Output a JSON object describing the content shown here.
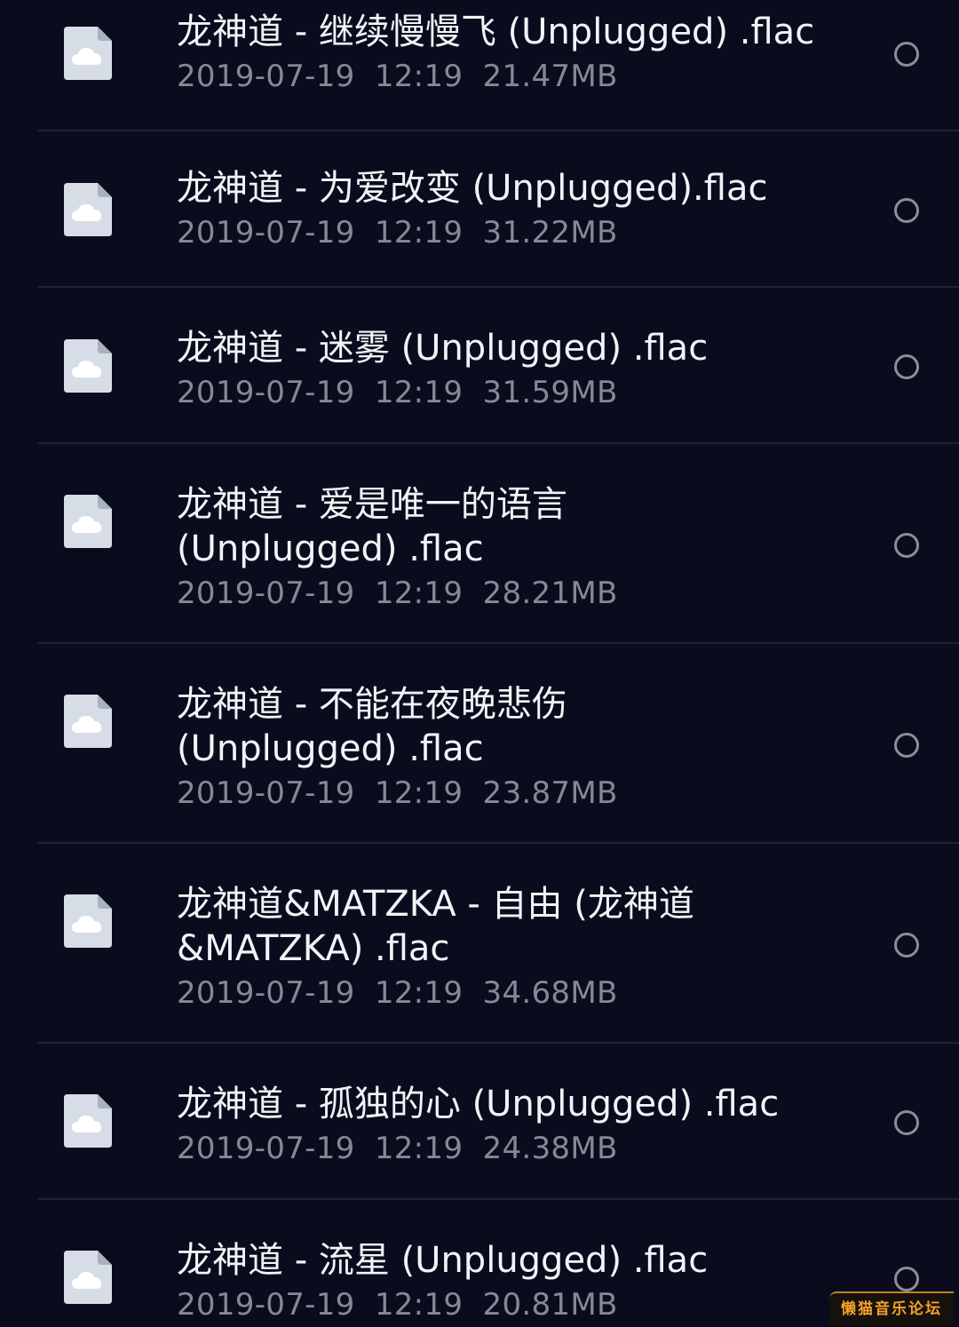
{
  "files": [
    {
      "name": "龙神道 - 继续慢慢飞 (Unplugged) .flac",
      "date": "2019-07-19",
      "time": "12:19",
      "size": "21.47MB",
      "icon": "cloud-file-icon"
    },
    {
      "name": "龙神道 - 为爱改变 (Unplugged).flac",
      "date": "2019-07-19",
      "time": "12:19",
      "size": "31.22MB",
      "icon": "cloud-file-icon"
    },
    {
      "name": "龙神道 - 迷雾 (Unplugged) .flac",
      "date": "2019-07-19",
      "time": "12:19",
      "size": "31.59MB",
      "icon": "cloud-file-icon"
    },
    {
      "name_line1": "龙神道 - 爱是唯一的语言",
      "name_line2": "(Unplugged) .flac",
      "date": "2019-07-19",
      "time": "12:19",
      "size": "28.21MB",
      "icon": "cloud-file-icon"
    },
    {
      "name_line1": "龙神道 - 不能在夜晚悲伤",
      "name_line2": "(Unplugged) .flac",
      "date": "2019-07-19",
      "time": "12:19",
      "size": "23.87MB",
      "icon": "cloud-file-icon"
    },
    {
      "name_line1": "龙神道&MATZKA - 自由 (龙神道",
      "name_line2": "&MATZKA) .flac",
      "date": "2019-07-19",
      "time": "12:19",
      "size": "34.68MB",
      "icon": "cloud-file-icon"
    },
    {
      "name": "龙神道 - 孤独的心 (Unplugged) .flac",
      "date": "2019-07-19",
      "time": "12:19",
      "size": "24.38MB",
      "icon": "cloud-file-icon"
    },
    {
      "name": "龙神道 - 流星 (Unplugged) .flac",
      "date": "2019-07-19",
      "time": "12:19",
      "size": "20.81MB",
      "icon": "cloud-file-icon"
    }
  ],
  "watermark": "懒猫音乐论坛",
  "colors": {
    "background": "#0a0c1e",
    "title_text": "#f2f3f6",
    "meta_text": "#868896",
    "icon_fill": "#d7dde6",
    "watermark_accent": "#f2a12b"
  }
}
